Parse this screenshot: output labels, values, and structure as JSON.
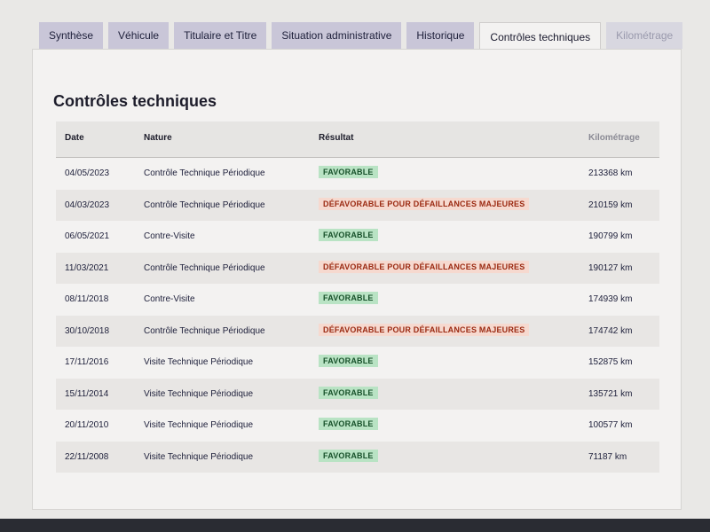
{
  "tabs": [
    {
      "label": "Synthèse",
      "state": "normal"
    },
    {
      "label": "Véhicule",
      "state": "normal"
    },
    {
      "label": "Titulaire et Titre",
      "state": "normal"
    },
    {
      "label": "Situation administrative",
      "state": "normal"
    },
    {
      "label": "Historique",
      "state": "normal"
    },
    {
      "label": "Contrôles techniques",
      "state": "active"
    },
    {
      "label": "Kilométrage",
      "state": "disabled"
    }
  ],
  "page_title": "Contrôles techniques",
  "table": {
    "headers": {
      "date": "Date",
      "nature": "Nature",
      "result": "Résultat",
      "km": "Kilométrage"
    },
    "rows": [
      {
        "date": "04/05/2023",
        "nature": "Contrôle Technique Périodique",
        "result": "FAVORABLE",
        "result_type": "favorable",
        "km": "213368 km"
      },
      {
        "date": "04/03/2023",
        "nature": "Contrôle Technique Périodique",
        "result": "DÉFAVORABLE POUR DÉFAILLANCES MAJEURES",
        "result_type": "defavorable",
        "km": "210159 km"
      },
      {
        "date": "06/05/2021",
        "nature": "Contre-Visite",
        "result": "FAVORABLE",
        "result_type": "favorable",
        "km": "190799 km"
      },
      {
        "date": "11/03/2021",
        "nature": "Contrôle Technique Périodique",
        "result": "DÉFAVORABLE POUR DÉFAILLANCES MAJEURES",
        "result_type": "defavorable",
        "km": "190127 km"
      },
      {
        "date": "08/11/2018",
        "nature": "Contre-Visite",
        "result": "FAVORABLE",
        "result_type": "favorable",
        "km": "174939 km"
      },
      {
        "date": "30/10/2018",
        "nature": "Contrôle Technique Périodique",
        "result": "DÉFAVORABLE POUR DÉFAILLANCES MAJEURES",
        "result_type": "defavorable",
        "km": "174742 km"
      },
      {
        "date": "17/11/2016",
        "nature": "Visite Technique Périodique",
        "result": "FAVORABLE",
        "result_type": "favorable",
        "km": "152875 km"
      },
      {
        "date": "15/11/2014",
        "nature": "Visite Technique Périodique",
        "result": "FAVORABLE",
        "result_type": "favorable",
        "km": "135721 km"
      },
      {
        "date": "20/11/2010",
        "nature": "Visite Technique Périodique",
        "result": "FAVORABLE",
        "result_type": "favorable",
        "km": "100577 km"
      },
      {
        "date": "22/11/2008",
        "nature": "Visite Technique Périodique",
        "result": "FAVORABLE",
        "result_type": "favorable",
        "km": "71187 km"
      }
    ]
  },
  "colors": {
    "tab_bg": "#c9c6d8",
    "favorable_bg": "#b9e3c4",
    "favorable_text": "#17512a",
    "defavorable_bg": "#f6d9cf",
    "defavorable_text": "#9b2a12"
  }
}
